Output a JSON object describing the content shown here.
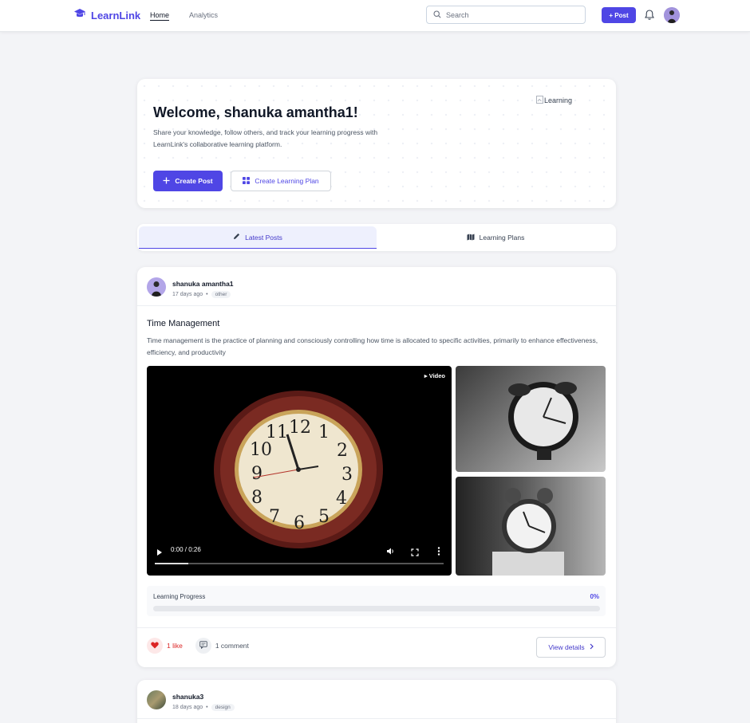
{
  "app": {
    "name": "LearnLink"
  },
  "nav": {
    "home": "Home",
    "analytics": "Analytics"
  },
  "search": {
    "placeholder": "Search"
  },
  "header": {
    "post_label": "+ Post"
  },
  "welcome": {
    "title": "Welcome, shanuka amantha1!",
    "description": "Share your knowledge, follow others, and track your learning progress with LearnLink's collaborative learning platform.",
    "image_alt": "Learning",
    "create_post": "Create Post",
    "create_plan": "Create Learning Plan"
  },
  "tabs": [
    {
      "label": "Latest Posts",
      "icon": "pencil-icon",
      "active": true
    },
    {
      "label": "Learning Plans",
      "icon": "map-icon",
      "active": false
    }
  ],
  "posts": [
    {
      "author": "shanuka amantha1",
      "time": "17 days ago",
      "separator": "•",
      "tag": "other",
      "title": "Time Management",
      "description": "Time management is the practice of planning and consciously controlling how time is allocated to specific activities, primarily to enhance effectiveness, efficiency, and productivity",
      "video": {
        "badge": "▸ Video",
        "time": "0:00 / 0:26",
        "played_fraction": 0
      },
      "progress": {
        "label": "Learning Progress",
        "value_text": "0%",
        "fraction": 0
      },
      "likes": "1 like",
      "comments": "1 comment",
      "view_details": "View details"
    },
    {
      "author": "shanuka3",
      "time": "18 days ago",
      "separator": "•",
      "tag": "design"
    }
  ],
  "colors": {
    "accent": "#4f46e5",
    "like": "#dc2626",
    "background": "#f3f4f7"
  }
}
